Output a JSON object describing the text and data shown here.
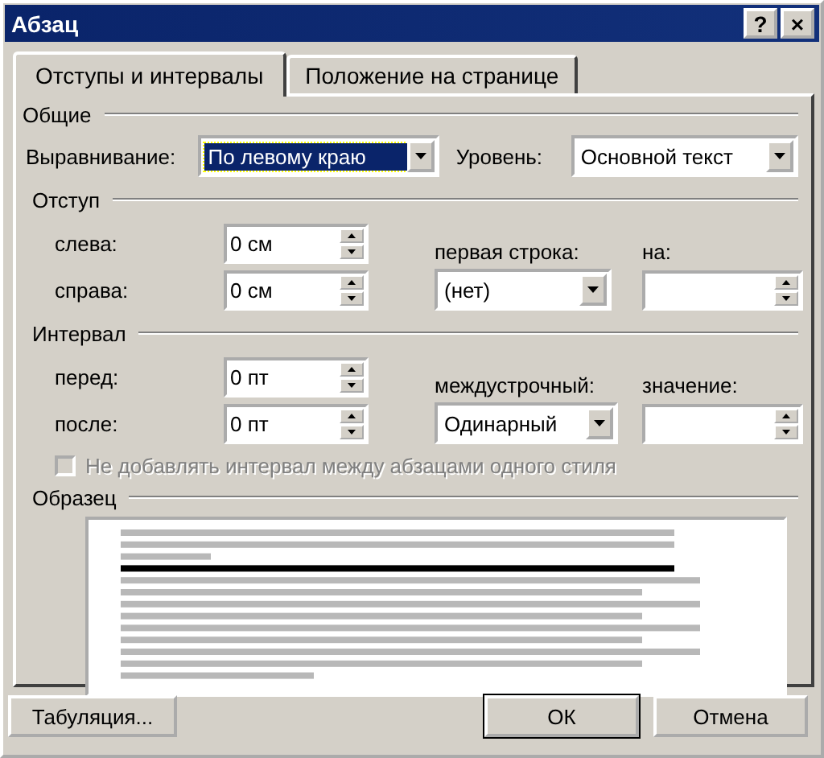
{
  "window": {
    "title": "Абзац",
    "help": "?",
    "close": "×"
  },
  "tabs": [
    {
      "label": "Отступы и интервалы",
      "selected": true
    },
    {
      "label": "Положение на странице",
      "selected": false
    }
  ],
  "general": {
    "heading": "Общие",
    "alignment": {
      "label": "Выравнивание:",
      "value": "По левому краю",
      "focused": true
    },
    "level": {
      "label": "Уровень:",
      "value": "Основной текст",
      "focused": false
    }
  },
  "indent": {
    "heading": "Отступ",
    "left": {
      "label": "слева:",
      "value": "0 см"
    },
    "right": {
      "label": "справа:",
      "value": "0 см"
    },
    "first_line": {
      "label": "первая строка:",
      "value": "(нет)",
      "focused": false
    },
    "by": {
      "label": "на:"
    }
  },
  "spacing": {
    "heading": "Интервал",
    "before": {
      "label": "перед:",
      "value": "0 пт"
    },
    "after": {
      "label": "после:",
      "value": "0 пт"
    },
    "line_spacing": {
      "label": "междустрочный:",
      "value": "Одинарный",
      "focused": false
    },
    "at": {
      "label": "значение:"
    }
  },
  "no_space_option": {
    "label": "Не добавлять интервал между абзацами одного стиля",
    "checked": false,
    "disabled": true
  },
  "preview": {
    "heading": "Образец"
  },
  "tabs_button": {
    "label": "Табуляция..."
  },
  "buttons": [
    {
      "label": "ОК",
      "default": true
    },
    {
      "label": "Отмена",
      "default": false
    }
  ]
}
